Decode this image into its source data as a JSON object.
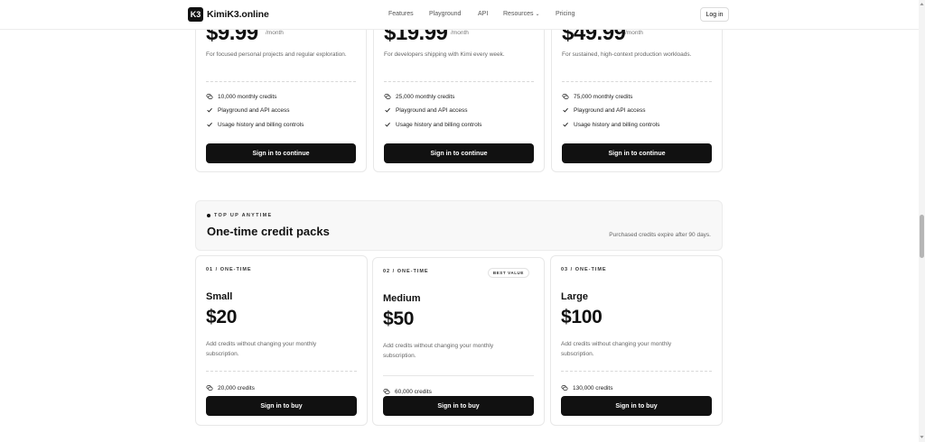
{
  "nav": {
    "logo_text": "K3",
    "brand": "KimiK3.online",
    "links": [
      "Features",
      "Playground",
      "API",
      "Resources",
      "Pricing"
    ],
    "login": "Log in"
  },
  "subscriptions": [
    {
      "price": "$9.99",
      "period": "/month",
      "description": "For focused personal projects and regular exploration.",
      "features": [
        "10,000 monthly credits",
        "Playground and API access",
        "Usage history and billing controls"
      ],
      "button": "Sign in to continue"
    },
    {
      "price": "$19.99",
      "period": "/month",
      "description": "For developers shipping with Kimi every week.",
      "features": [
        "25,000 monthly credits",
        "Playground and API access",
        "Usage history and billing controls"
      ],
      "button": "Sign in to continue"
    },
    {
      "price": "$49.99",
      "period": "/month",
      "description": "For sustained, high-context production workloads.",
      "features": [
        "75,000 monthly credits",
        "Playground and API access",
        "Usage history and billing controls"
      ],
      "button": "Sign in to continue"
    }
  ],
  "topup": {
    "kicker": "TOP UP ANYTIME",
    "title": "One-time credit packs",
    "note": "Purchased credits expire after 90 days."
  },
  "packs": [
    {
      "kicker": "01 / ONE-TIME",
      "name": "Small",
      "price": "$20",
      "description": "Add credits without changing your monthly subscription.",
      "credits": "20,000 credits",
      "button": "Sign in to buy"
    },
    {
      "kicker": "02 / ONE-TIME",
      "badge": "BEST VALUE",
      "name": "Medium",
      "price": "$50",
      "description": "Add credits without changing your monthly subscription.",
      "credits": "60,000 credits",
      "button": "Sign in to buy"
    },
    {
      "kicker": "03 / ONE-TIME",
      "name": "Large",
      "price": "$100",
      "description": "Add credits without changing your monthly subscription.",
      "credits": "130,000 credits",
      "button": "Sign in to buy"
    }
  ],
  "icons": {
    "credits": "coins-icon",
    "included": "check-icon",
    "dropdown": "chevron-down-icon"
  },
  "colors": {
    "accent": "#111111",
    "page_bg": "#ffffff",
    "section_bg": "#f8f8f8"
  }
}
